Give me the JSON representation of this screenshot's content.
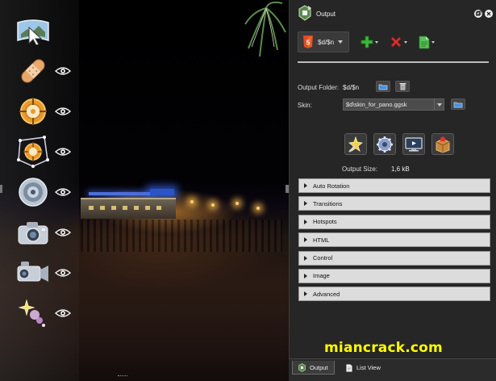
{
  "viewer": {
    "tools": [
      {
        "name": "viewer-tool",
        "icon": "panorama-pointer-icon",
        "has_eye": false
      },
      {
        "name": "patch-tool",
        "icon": "bandage-icon",
        "has_eye": true
      },
      {
        "name": "hotspot-tool",
        "icon": "target-icon",
        "has_eye": true
      },
      {
        "name": "polygon-hotspot-tool",
        "icon": "polygon-target-icon",
        "has_eye": true
      },
      {
        "name": "sound-tool",
        "icon": "speaker-icon",
        "has_eye": true
      },
      {
        "name": "image-tool",
        "icon": "camera-icon",
        "has_eye": true
      },
      {
        "name": "video-tool",
        "icon": "video-camera-icon",
        "has_eye": true
      },
      {
        "name": "lensflare-tool",
        "icon": "lensflare-icon",
        "has_eye": true
      }
    ]
  },
  "panel": {
    "title": "Output",
    "output_format": {
      "value": "$d/$n",
      "icon": "html5-icon"
    },
    "toolbar": {
      "add": "add-icon",
      "remove": "remove-icon",
      "document": "document-icon"
    },
    "output_folder": {
      "label": "Output Folder:",
      "value": "$d/$n"
    },
    "skin": {
      "label": "Skin:",
      "value": "$d\\skin_for_pano.ggsk"
    },
    "output_size": {
      "label": "Output Size:",
      "value": "1,6 kB"
    },
    "sections": [
      "Auto Rotation",
      "Transitions",
      "Hotspots",
      "HTML",
      "Control",
      "Image",
      "Advanced"
    ]
  },
  "watermark": "miancrack.com",
  "tabs": [
    {
      "label": "Output",
      "active": true
    },
    {
      "label": "List View",
      "active": false
    }
  ],
  "colors": {
    "panel_bg": "#262626",
    "section_bg": "#dcdcdc",
    "watermark": "#ffff00",
    "accent_red": "#d33",
    "accent_green": "#3cb83c"
  }
}
